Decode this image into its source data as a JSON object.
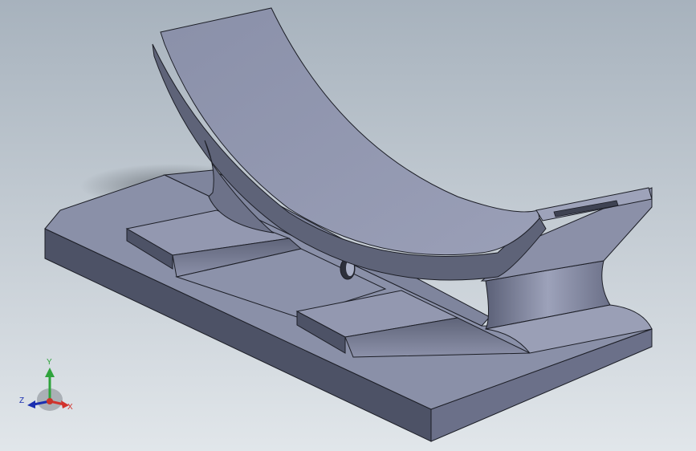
{
  "viewport": {
    "background_top": "#a7b2bd",
    "background_bottom": "#e1e6ea"
  },
  "model": {
    "description_icon": "cad-part-icon",
    "face_colors": {
      "top_light": "#8d93ac",
      "side_dark": "#4e5367",
      "side_mid": "#6a7088",
      "edge": "#1c1e26"
    }
  },
  "triad": {
    "x_label": "X",
    "y_label": "Y",
    "z_label": "Z",
    "x_color": "#d2322d",
    "y_color": "#2fa33c",
    "z_color": "#1b2fb0"
  }
}
